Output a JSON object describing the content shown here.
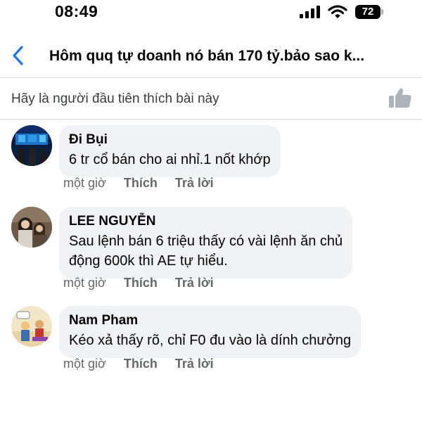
{
  "status_bar": {
    "time": "08:49",
    "battery": "72",
    "icons": [
      "signal-icon",
      "wifi-icon",
      "battery-icon"
    ]
  },
  "header": {
    "back_icon": "chevron-left-icon",
    "title": "Hôm quq tự doanh nó bán 170 tỷ.bảo sao k..."
  },
  "likes": {
    "text": "Hãy là người đầu tiên thích bài này",
    "icon": "thumbs-up-icon"
  },
  "comments": [
    {
      "author": "Đi Bụi",
      "lines": [
        "6 tr cổ bán cho ai nhỉ.1 nốt khớp"
      ],
      "time": "một giờ",
      "like_label": "Thích",
      "reply_label": "Trả lời"
    },
    {
      "author": "LEE NGUYỄN",
      "lines": [
        "Sau lệnh bán 6 triệu thấy có vài lệnh ăn chủ",
        "động 600k thì AE tự hiểu."
      ],
      "time": "một giờ",
      "like_label": "Thích",
      "reply_label": "Trả lời"
    },
    {
      "author": "Nam Pham",
      "lines": [
        "Kéo xả thấy rõ, chỉ F0 đu vào là dính chưởng"
      ],
      "time": "một giờ",
      "like_label": "Thích",
      "reply_label": "Trả lời"
    }
  ],
  "colors": {
    "accent": "#1877f2",
    "bubble": "#f0f2f5",
    "secondary_text": "#65676b",
    "divider": "#dadde1"
  }
}
